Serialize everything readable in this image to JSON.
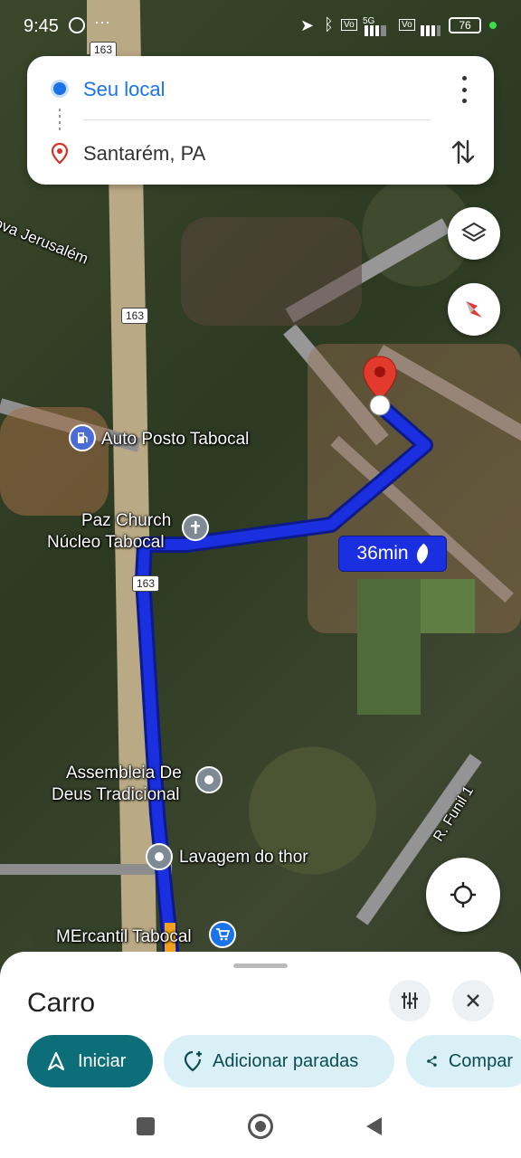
{
  "status_bar": {
    "time": "9:45",
    "battery": "76",
    "network": "5G"
  },
  "route": {
    "origin": "Seu local",
    "destination": "Santarém, PA"
  },
  "map": {
    "road_shield": "163",
    "street_labels": [
      "ova Jerusalém",
      "R. Funil 1"
    ],
    "places": {
      "posto": "Auto Posto Tabocal",
      "church_line1": "Paz Church",
      "church_line2": "Núcleo Tabocal",
      "assembleia_line1": "Assembleia De",
      "assembleia_line2": "Deus Tradicional",
      "lavagem": "Lavagem do thor",
      "mercantil": "MErcantil Tabocal"
    },
    "eta": "36min"
  },
  "sheet": {
    "title": "Carro",
    "start_label": "Iniciar",
    "add_stops_label": "Adicionar paradas",
    "share_label": "Compar"
  },
  "colors": {
    "route": "#1a2fe0",
    "start_button": "#0b6e78",
    "chip_bg": "#d9f0f6",
    "accent_blue": "#1a73e8"
  }
}
